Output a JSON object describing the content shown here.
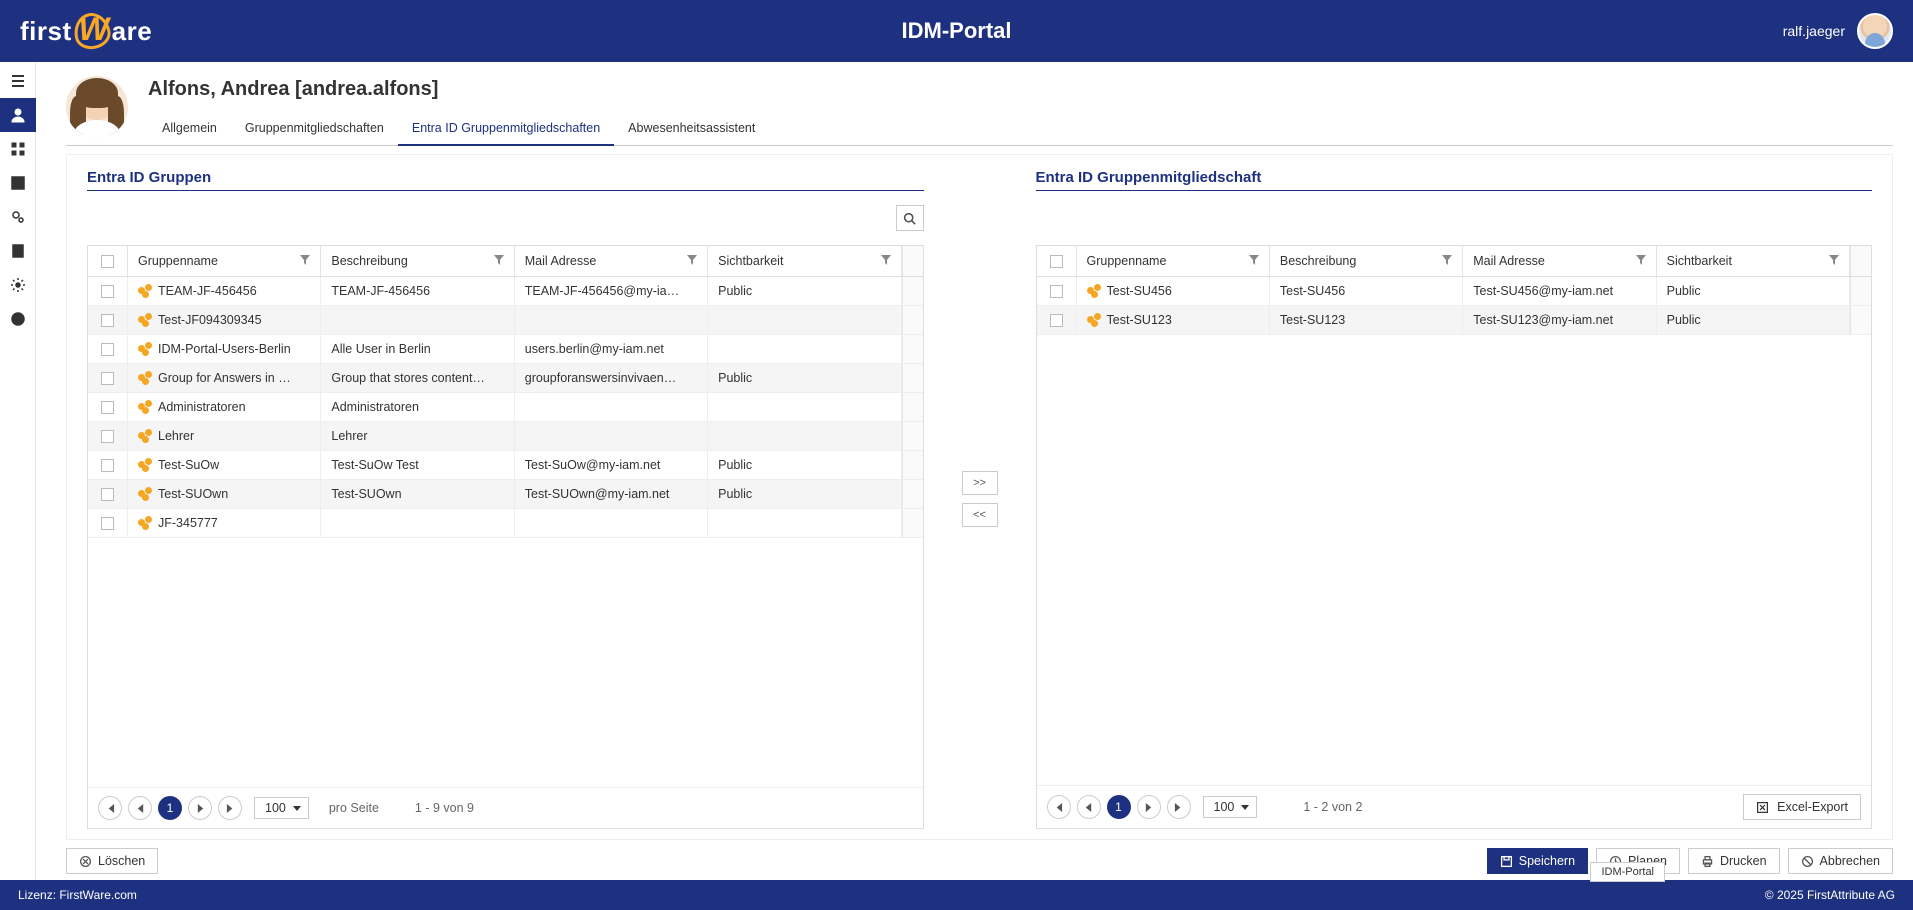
{
  "app": {
    "title": "IDM-Portal",
    "logo_left": "first",
    "logo_right": "are",
    "logo_w": "W"
  },
  "user": {
    "name": "ralf.jaeger"
  },
  "object": {
    "title": "Alfons, Andrea [andrea.alfons]"
  },
  "tabs": [
    {
      "label": "Allgemein",
      "active": false
    },
    {
      "label": "Gruppenmitgliedschaften",
      "active": false
    },
    {
      "label": "Entra ID Gruppenmitgliedschaften",
      "active": true
    },
    {
      "label": "Abwesenheitsassistent",
      "active": false
    }
  ],
  "sections": {
    "left_title": "Entra ID Gruppen",
    "right_title": "Entra ID Gruppenmitgliedschaft"
  },
  "columns": {
    "name": "Gruppenname",
    "desc": "Beschreibung",
    "mail": "Mail Adresse",
    "vis": "Sichtbarkeit"
  },
  "left_rows": [
    {
      "name": "TEAM-JF-456456",
      "desc": "TEAM-JF-456456",
      "mail": "TEAM-JF-456456@my-ia…",
      "vis": "Public"
    },
    {
      "name": "Test-JF094309345",
      "desc": "",
      "mail": "",
      "vis": ""
    },
    {
      "name": "IDM-Portal-Users-Berlin",
      "desc": "Alle User in Berlin",
      "mail": "users.berlin@my-iam.net",
      "vis": ""
    },
    {
      "name": "Group for Answers in …",
      "desc": "Group that stores content…",
      "mail": "groupforanswersinvivaen…",
      "vis": "Public"
    },
    {
      "name": "Administratoren",
      "desc": "Administratoren",
      "mail": "",
      "vis": ""
    },
    {
      "name": "Lehrer",
      "desc": "Lehrer",
      "mail": "",
      "vis": ""
    },
    {
      "name": "Test-SuOw",
      "desc": "Test-SuOw Test",
      "mail": "Test-SuOw@my-iam.net",
      "vis": "Public"
    },
    {
      "name": "Test-SUOwn",
      "desc": "Test-SUOwn",
      "mail": "Test-SUOwn@my-iam.net",
      "vis": "Public"
    },
    {
      "name": "JF-345777",
      "desc": "",
      "mail": "",
      "vis": ""
    }
  ],
  "right_rows": [
    {
      "name": "Test-SU456",
      "desc": "Test-SU456",
      "mail": "Test-SU456@my-iam.net",
      "vis": "Public"
    },
    {
      "name": "Test-SU123",
      "desc": "Test-SU123",
      "mail": "Test-SU123@my-iam.net",
      "vis": "Public"
    }
  ],
  "pager": {
    "size": "100",
    "per_page_label": "pro Seite",
    "left_info": "1 - 9 von 9",
    "right_info": "1 - 2 von 2",
    "current": "1"
  },
  "transfer": {
    "add": ">>",
    "remove": "<<"
  },
  "export_label": "Excel-Export",
  "actions": {
    "delete": "Löschen",
    "save": "Speichern",
    "plan": "Planen",
    "print": "Drucken",
    "cancel": "Abbrechen"
  },
  "footer": {
    "license": "Lizenz: FirstWare.com",
    "copyright": "© 2025 FirstAttribute AG",
    "badge": "IDM-Portal"
  }
}
